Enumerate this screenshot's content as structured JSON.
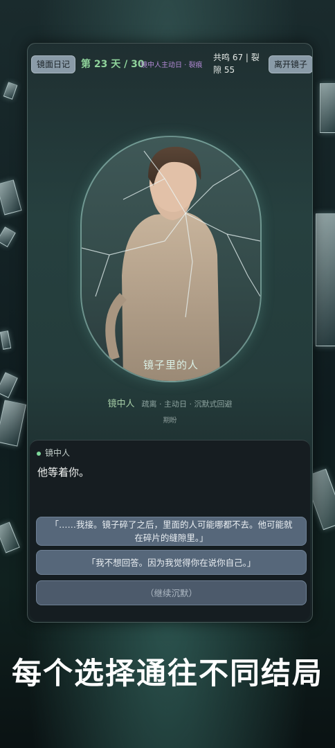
{
  "topbar": {
    "diary_label": "镜面日记",
    "day_label": "第 23 天 / 30",
    "event_label": "镜中人主动日 · 裂痕",
    "stats_label": "共鸣 67 | 裂隙 55",
    "leave_label": "离开镜子"
  },
  "portrait": {
    "caption": "镜子里的人"
  },
  "character": {
    "name": "镜中人",
    "traits": "疏离 · 主动日 · 沉默式回避",
    "mood": "期盼"
  },
  "dialog": {
    "speaker": "镜中人",
    "line": "他等着你。",
    "choices": [
      "「……我接。镜子碎了之后，里面的人可能哪都不去。他可能就在碎片的缝隙里。」",
      "「我不想回答。因为我觉得你在说你自己。」",
      "（继续沉默）"
    ]
  },
  "slogan": "每个选择通往不同结局"
}
